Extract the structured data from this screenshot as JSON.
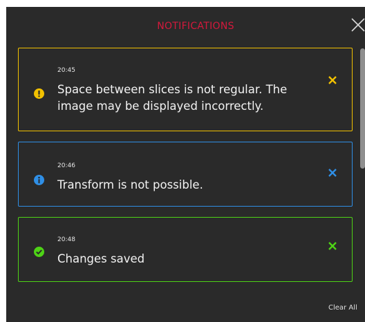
{
  "window": {
    "title": "NOTIFICATIONS",
    "title_color": "#d4193c",
    "background": "#2a2a2a"
  },
  "notifications": [
    {
      "type": "warning",
      "time": "20:45",
      "message": "Space between slices is not regular. The image may be displayed incorrectly.",
      "color": "#f2c100",
      "icon": "exclamation-icon"
    },
    {
      "type": "info",
      "time": "20:46",
      "message": "Transform is not possible.",
      "color": "#2f8fe6",
      "icon": "info-icon"
    },
    {
      "type": "success",
      "time": "20:48",
      "message": "Changes saved",
      "color": "#4ed316",
      "icon": "check-icon"
    }
  ],
  "footer": {
    "clear_all_label": "Clear All"
  }
}
